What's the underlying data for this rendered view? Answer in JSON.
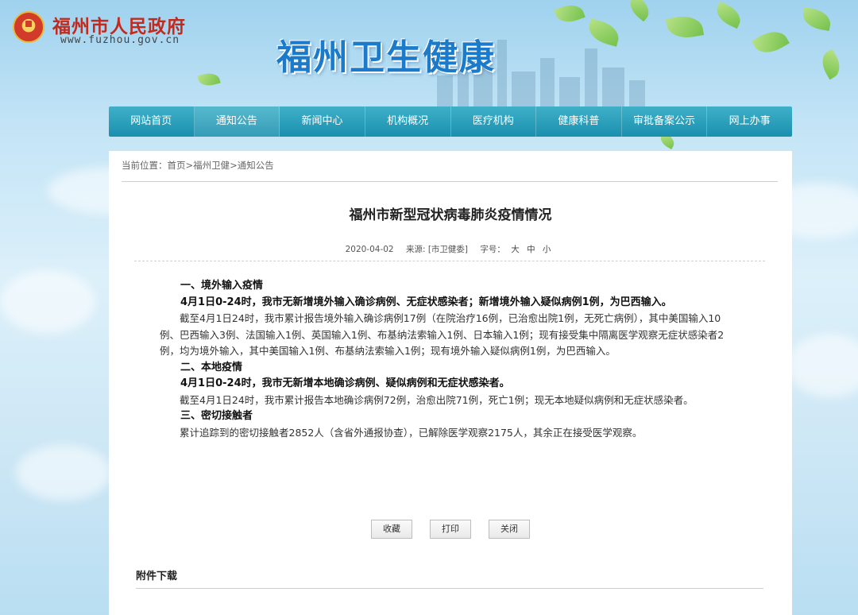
{
  "header": {
    "site_name": "福州市人民政府",
    "site_url": "www.fuzhou.gov.cn",
    "banner_title": "福州卫生健康"
  },
  "nav": {
    "items": [
      "网站首页",
      "通知公告",
      "新闻中心",
      "机构概况",
      "医疗机构",
      "健康科普",
      "审批备案公示",
      "网上办事"
    ]
  },
  "breadcrumb": {
    "prefix": "当前位置：",
    "items": [
      "首页",
      "福州卫健",
      "通知公告"
    ],
    "separator": ">"
  },
  "article": {
    "title": "福州市新型冠状病毒肺炎疫情情况",
    "date": "2020-04-02",
    "source": "来源: [市卫健委]",
    "font_size_label": "字号：",
    "font_sizes": [
      "大",
      "中",
      "小"
    ],
    "paragraphs": [
      {
        "bold": true,
        "text": "一、境外输入疫情"
      },
      {
        "bold": true,
        "text": "4月1日0-24时，我市无新增境外输入确诊病例、无症状感染者；新增境外输入疑似病例1例，为巴西输入。"
      },
      {
        "bold": false,
        "text": "截至4月1日24时，我市累计报告境外输入确诊病例17例（在院治疗16例，已治愈出院1例，无死亡病例），其中美国输入10例、巴西输入3例、法国输入1例、英国输入1例、布基纳法索输入1例、日本输入1例；现有接受集中隔离医学观察无症状感染者2例，均为境外输入，其中美国输入1例、布基纳法索输入1例；现有境外输入疑似病例1例，为巴西输入。"
      },
      {
        "bold": true,
        "text": "二、本地疫情"
      },
      {
        "bold": true,
        "text": "4月1日0-24时，我市无新增本地确诊病例、疑似病例和无症状感染者。"
      },
      {
        "bold": false,
        "text": "截至4月1日24时，我市累计报告本地确诊病例72例，治愈出院71例，死亡1例；现无本地疑似病例和无症状感染者。"
      },
      {
        "bold": true,
        "text": "三、密切接触者"
      },
      {
        "bold": false,
        "text": "累计追踪到的密切接触者2852人（含省外通报协查），已解除医学观察2175人，其余正在接受医学观察。"
      }
    ]
  },
  "actions": {
    "collect": "收藏",
    "print": "打印",
    "close": "关闭"
  },
  "attachments": {
    "label": "附件下载"
  }
}
